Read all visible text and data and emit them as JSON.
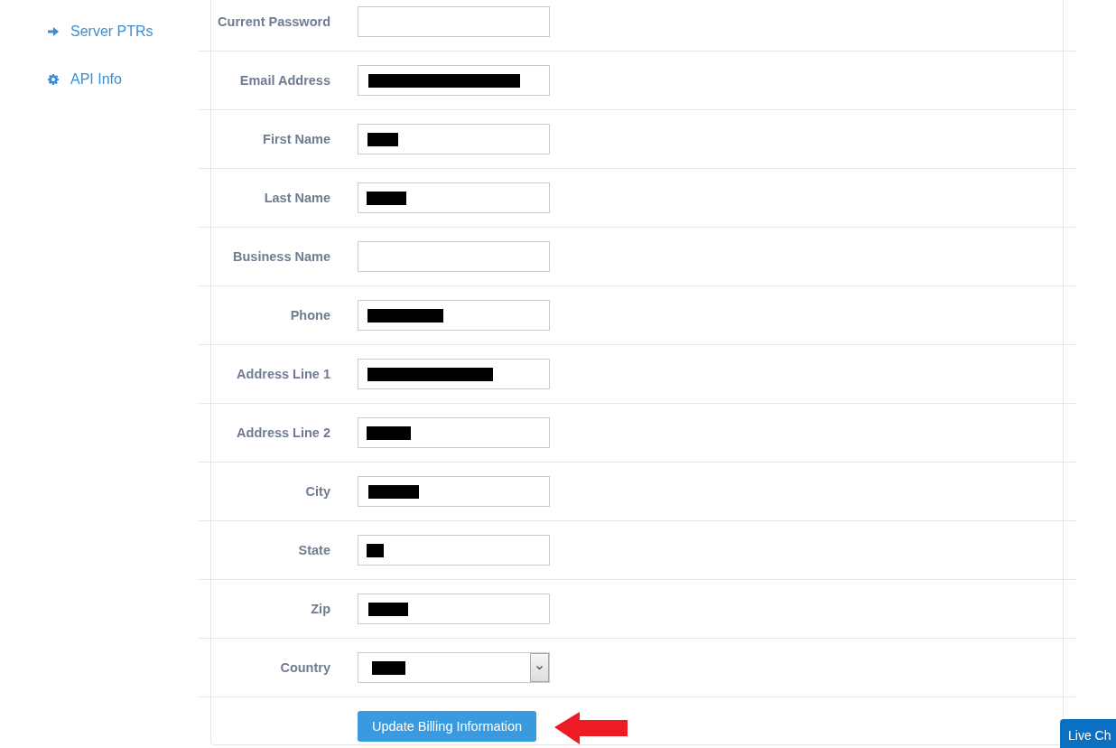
{
  "sidebar": {
    "items": [
      {
        "label": "Server PTRs"
      },
      {
        "label": "API Info"
      }
    ]
  },
  "form": {
    "rows": [
      {
        "label": "Current Password",
        "kind": "text",
        "redacted": false
      },
      {
        "label": "Email Address",
        "kind": "text",
        "redacted": true
      },
      {
        "label": "First Name",
        "kind": "text",
        "redacted": true
      },
      {
        "label": "Last Name",
        "kind": "text",
        "redacted": true
      },
      {
        "label": "Business Name",
        "kind": "text",
        "redacted": false
      },
      {
        "label": "Phone",
        "kind": "text",
        "redacted": true
      },
      {
        "label": "Address Line 1",
        "kind": "text",
        "redacted": true
      },
      {
        "label": "Address Line 2",
        "kind": "text",
        "redacted": true
      },
      {
        "label": "City",
        "kind": "text",
        "redacted": true
      },
      {
        "label": "State",
        "kind": "text",
        "redacted": true
      },
      {
        "label": "Zip",
        "kind": "text",
        "redacted": true
      },
      {
        "label": "Country",
        "kind": "select",
        "redacted": true
      }
    ],
    "submit": {
      "label": "Update Billing Information"
    }
  },
  "live_chat": {
    "label": "Live Ch"
  }
}
